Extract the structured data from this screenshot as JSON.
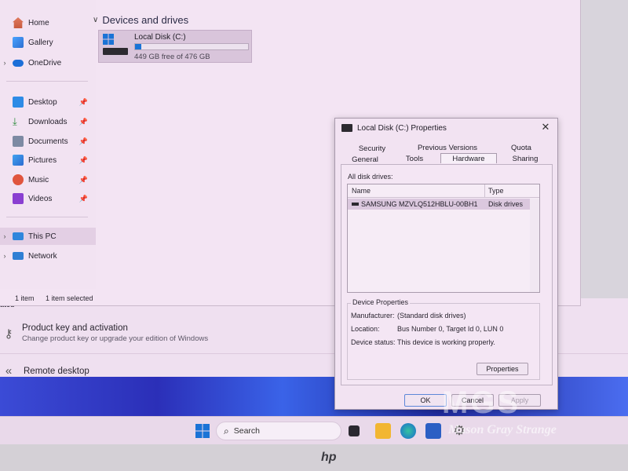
{
  "explorer": {
    "nav": {
      "home": "Home",
      "gallery": "Gallery",
      "onedrive": "OneDrive",
      "desktop": "Desktop",
      "downloads": "Downloads",
      "documents": "Documents",
      "pictures": "Pictures",
      "music": "Music",
      "videos": "Videos",
      "this_pc": "This PC",
      "network": "Network"
    },
    "section_title": "Devices and drives",
    "drive": {
      "name": "Local Disk (C:)",
      "free_text": "449 GB free of 476 GB",
      "used_fraction": 0.057
    },
    "status": {
      "count": "1 item",
      "selected": "1 item selected"
    }
  },
  "settings": {
    "section_fragment": "ated",
    "product_key_title": "Product key and activation",
    "product_key_sub": "Change product key or upgrade your edition of Windows",
    "remote_desktop": "Remote desktop"
  },
  "dialog": {
    "title": "Local Disk (C:) Properties",
    "tabs_row1": [
      "Security",
      "Previous Versions",
      "Quota"
    ],
    "tabs_row2": [
      "General",
      "Tools",
      "Hardware",
      "Sharing"
    ],
    "active_tab": "Hardware",
    "all_disk_drives_label": "All disk drives:",
    "columns": [
      "Name",
      "Type"
    ],
    "rows": [
      {
        "name": "SAMSUNG MZVLQ512HBLU-00BH1",
        "type": "Disk drives"
      }
    ],
    "device_properties": {
      "title": "Device Properties",
      "manufacturer_label": "Manufacturer:",
      "manufacturer_value": "(Standard disk drives)",
      "location_label": "Location:",
      "location_value": "Bus Number 0, Target Id 0, LUN 0",
      "status_label": "Device status:",
      "status_value": "This device is working properly.",
      "properties_button": "Properties"
    },
    "buttons": {
      "ok": "OK",
      "cancel": "Cancel",
      "apply": "Apply"
    }
  },
  "taskbar": {
    "search_label": "Search"
  },
  "bezel": {
    "brand": "hp"
  },
  "watermark": {
    "logo": "MGS",
    "text": "Mason Gray Strange"
  },
  "colors": {
    "accent": "#1a73d6",
    "window_bg": "#f3e4f3",
    "selection": "#dbc8de"
  }
}
